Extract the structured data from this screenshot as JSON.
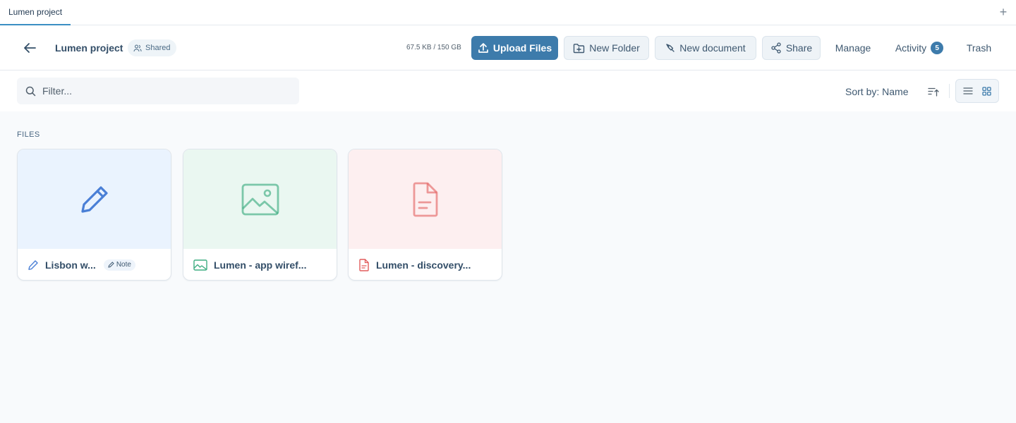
{
  "tab": {
    "label": "Lumen project",
    "add_symbol": "+"
  },
  "header": {
    "title": "Lumen project",
    "shared_badge": "Shared",
    "storage": "67.5 KB / 150 GB",
    "upload_label": "Upload Files",
    "new_folder_label": "New Folder",
    "new_document_label": "New document",
    "share_label": "Share",
    "manage_label": "Manage",
    "activity_label": "Activity",
    "activity_count": "5",
    "trash_label": "Trash"
  },
  "toolbar": {
    "filter_placeholder": "Filter...",
    "sort_label": "Sort by: Name",
    "view_modes": [
      "list-view-icon",
      "grid-view-icon"
    ],
    "active_view": "grid-view-icon"
  },
  "files_section": {
    "label": "FILES",
    "items": [
      {
        "name": "Lisbon w...",
        "icon": "pencil-icon",
        "badge": "Note",
        "thumb_color": "#eaf3fe",
        "icon_color": "#4a7fd6"
      },
      {
        "name": "Lumen - app wiref...",
        "icon": "image-icon",
        "thumb_color": "#eaf7f1",
        "icon_color": "#3fae82"
      },
      {
        "name": "Lumen - discovery...",
        "icon": "document-icon",
        "thumb_color": "#fdeff0",
        "icon_color": "#e25d5d"
      }
    ]
  },
  "colors": {
    "primary": "#3d7bab",
    "text": "#334e68",
    "background": "#f8fafc"
  }
}
